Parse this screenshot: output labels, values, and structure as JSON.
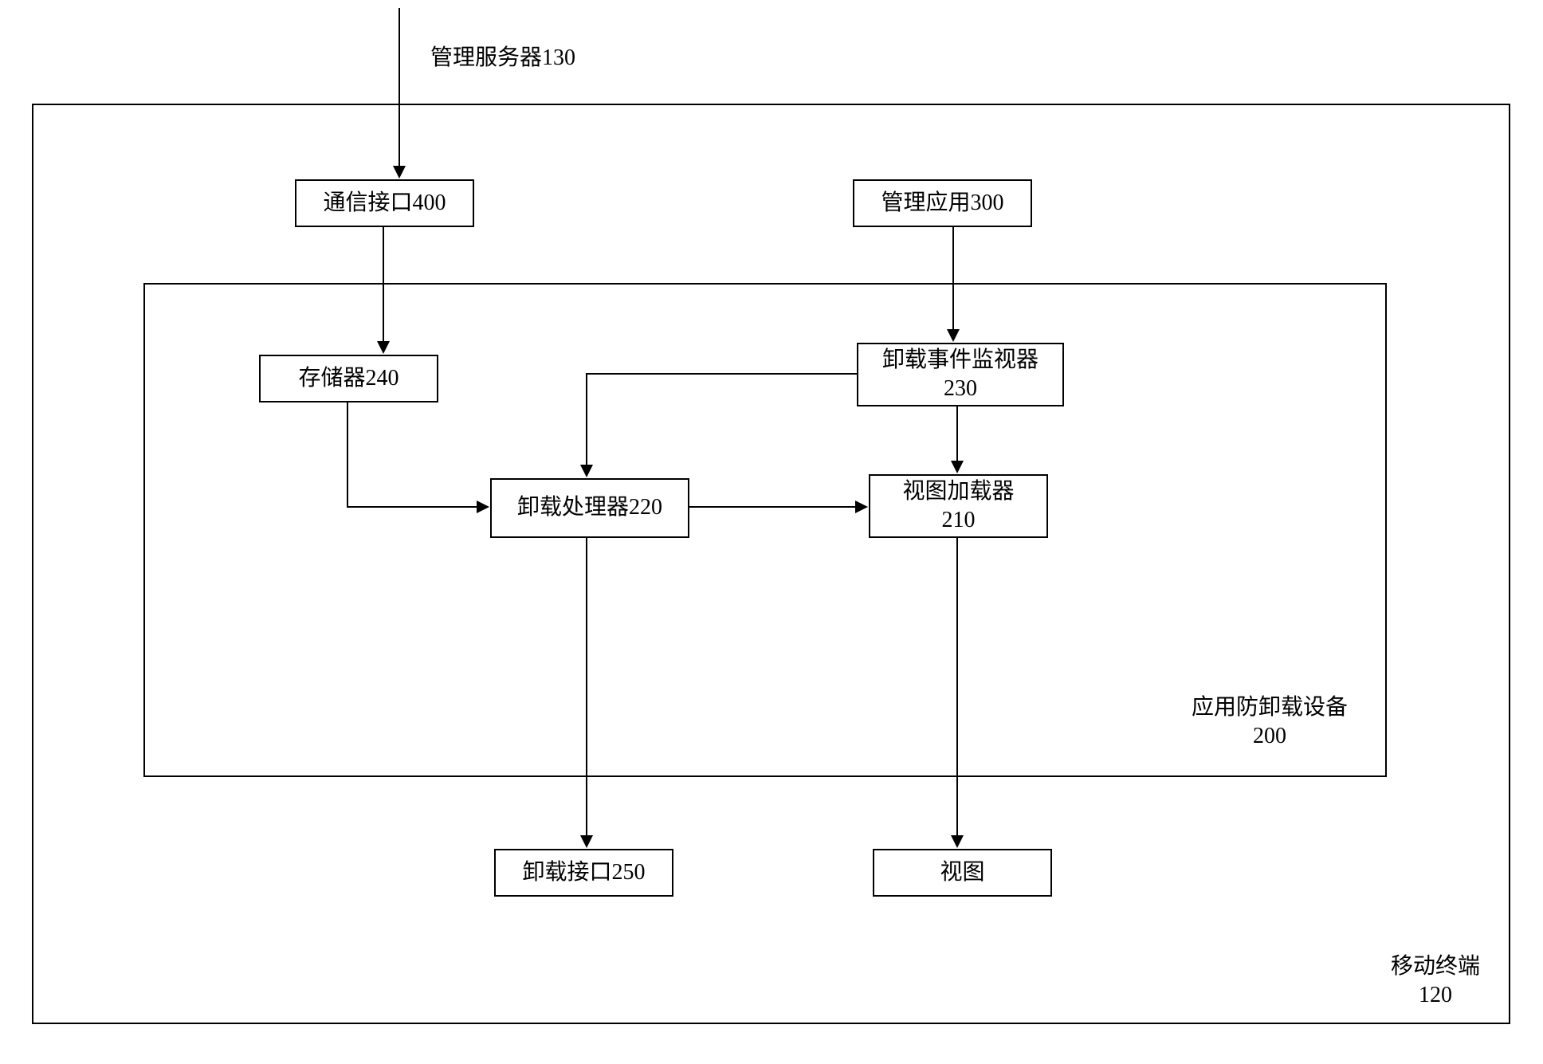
{
  "labels": {
    "management_server": "管理服务器130",
    "comm_interface": "通信接口400",
    "management_app": "管理应用300",
    "storage": "存储器240",
    "unload_monitor_l1": "卸载事件监视器",
    "unload_monitor_l2": "230",
    "unload_processor": "卸载处理器220",
    "view_loader_l1": "视图加载器",
    "view_loader_l2": "210",
    "anti_unload_l1": "应用防卸载设备",
    "anti_unload_l2": "200",
    "unload_interface": "卸载接口250",
    "view": "视图",
    "mobile_terminal_l1": "移动终端",
    "mobile_terminal_l2": "120"
  }
}
